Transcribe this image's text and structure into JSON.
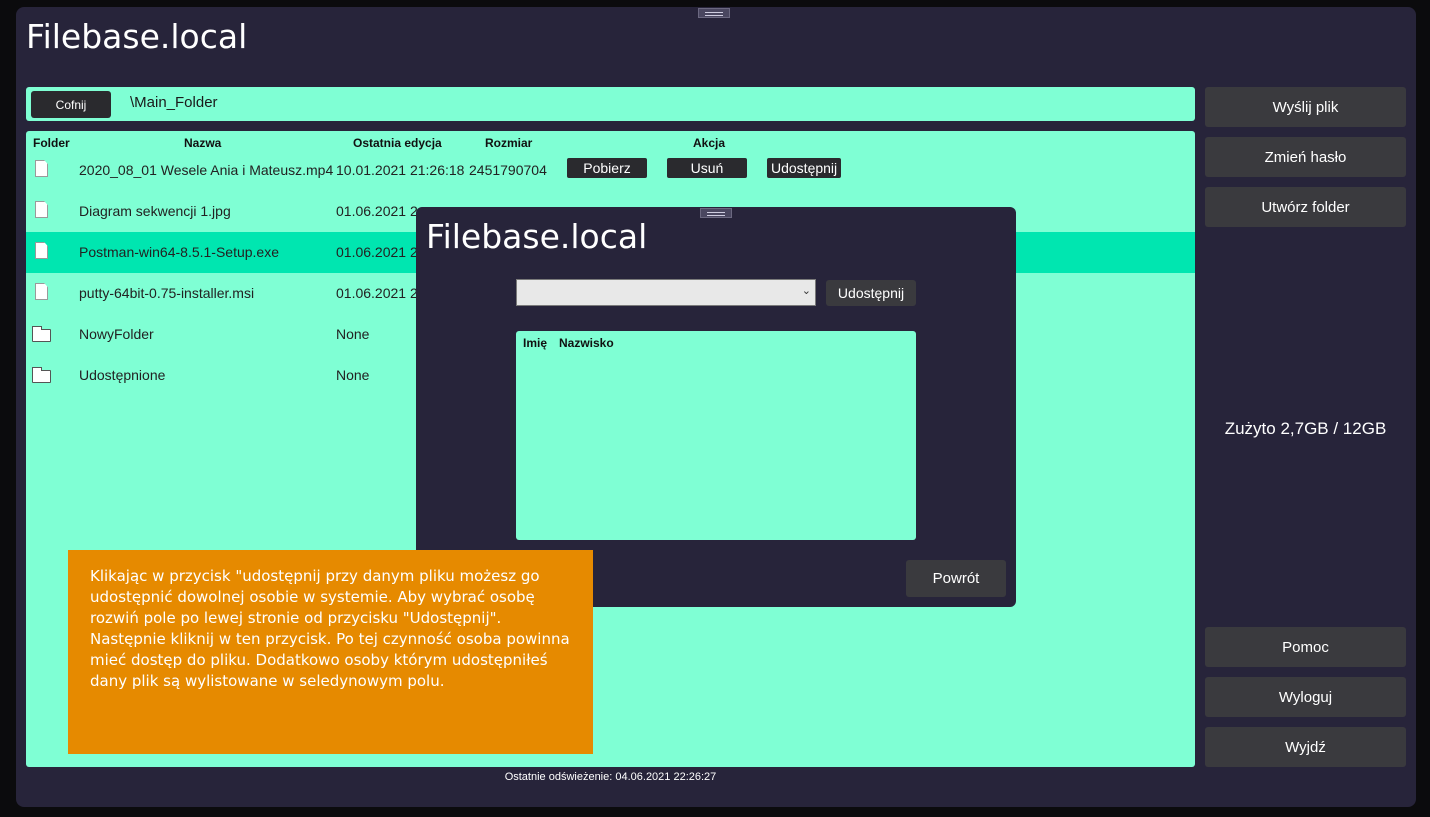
{
  "app": {
    "title": "Filebase.local"
  },
  "path": {
    "back_label": "Cofnij",
    "current": "\\Main_Folder"
  },
  "table": {
    "headers": {
      "folder": "Folder",
      "name": "Nazwa",
      "edited": "Ostatnia edycja",
      "size": "Rozmiar",
      "action": "Akcja"
    },
    "rows": [
      {
        "type": "file",
        "name": "2020_08_01 Wesele Ania i Mateusz.mp4",
        "edited": "10.01.2021 21:26:18",
        "size": "2451790704",
        "actions": true
      },
      {
        "type": "file",
        "name": "Diagram sekwencji 1.jpg",
        "edited": "01.06.2021 2",
        "size": "",
        "actions": false
      },
      {
        "type": "file",
        "name": "Postman-win64-8.5.1-Setup.exe",
        "edited": "01.06.2021 2",
        "size": "",
        "actions": false,
        "selected": true
      },
      {
        "type": "file",
        "name": "putty-64bit-0.75-installer.msi",
        "edited": "01.06.2021 2",
        "size": "",
        "actions": false
      },
      {
        "type": "folder",
        "name": "NowyFolder",
        "edited": "None",
        "size": "",
        "actions": false
      },
      {
        "type": "folder",
        "name": "Udostępnione",
        "edited": "None",
        "size": "",
        "actions": false
      }
    ],
    "action_labels": {
      "download": "Pobierz",
      "delete": "Usuń",
      "share": "Udostępnij"
    }
  },
  "sidebar": {
    "upload": "Wyślij plik",
    "change_password": "Zmień hasło",
    "create_folder": "Utwórz folder",
    "usage": "Zużyto 2,7GB / 12GB",
    "help": "Pomoc",
    "logout": "Wyloguj",
    "exit": "Wyjdź"
  },
  "status": {
    "last_refresh": "Ostatnie odświeżenie: 04.06.2021 22:26:27"
  },
  "dialog": {
    "title": "Filebase.local",
    "select_value": "",
    "share_label": "Udostępnij",
    "list_headers": {
      "first_name": "Imię",
      "last_name": "Nazwisko"
    },
    "back_label": "Powrót"
  },
  "help_tip": {
    "text": "Klikając w przycisk \"udostępnij przy danym pliku możesz go udostępnić dowolnej osobie w systemie. Aby wybrać osobę rozwiń pole po lewej stronie od przycisku \"Udostępnij\". Następnie kliknij w ten przycisk. Po tej czynność osoba powinna mieć dostęp do pliku. Dodatkowo osoby którym udostępniłeś dany plik są wylistowane w seledynowym polu."
  },
  "colors": {
    "panel": "#7fffd4",
    "selected_row": "#00e6b0",
    "window": "#27243a",
    "tip": "#e68a00"
  }
}
